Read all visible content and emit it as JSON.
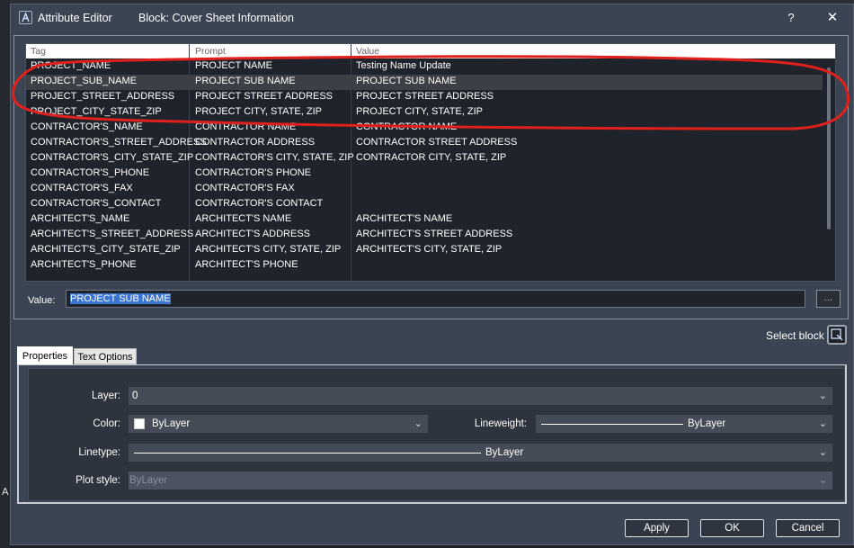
{
  "background": {
    "glyph": "A"
  },
  "window": {
    "title": "Attribute Editor",
    "block_label": "Block: Cover Sheet Information",
    "help": "?",
    "close": "✕"
  },
  "grid": {
    "headers": [
      "Tag",
      "Prompt",
      "Value"
    ],
    "rows": [
      {
        "tag": "PROJECT_NAME",
        "prompt": "PROJECT NAME",
        "value": "Testing Name Update"
      },
      {
        "tag": "PROJECT_SUB_NAME",
        "prompt": "PROJECT SUB NAME",
        "value": "PROJECT SUB NAME",
        "selected": true
      },
      {
        "tag": "PROJECT_STREET_ADDRESS",
        "prompt": "PROJECT STREET ADDRESS",
        "value": "PROJECT STREET ADDRESS"
      },
      {
        "tag": "PROJECT_CITY_STATE_ZIP",
        "prompt": "PROJECT CITY, STATE, ZIP",
        "value": "PROJECT CITY, STATE, ZIP"
      },
      {
        "tag": "CONTRACTOR'S_NAME",
        "prompt": "CONTRACTOR NAME",
        "value": "CONTRACTOR NAME"
      },
      {
        "tag": "CONTRACTOR'S_STREET_ADDRESS",
        "prompt": "CONTRACTOR ADDRESS",
        "value": "CONTRACTOR STREET ADDRESS"
      },
      {
        "tag": "CONTRACTOR'S_CITY_STATE_ZIP",
        "prompt": "CONTRACTOR'S CITY, STATE, ZIP",
        "value": "CONTRACTOR CITY, STATE, ZIP"
      },
      {
        "tag": "CONTRACTOR'S_PHONE",
        "prompt": "CONTRACTOR'S PHONE",
        "value": ""
      },
      {
        "tag": "CONTRACTOR'S_FAX",
        "prompt": "CONTRACTOR'S FAX",
        "value": ""
      },
      {
        "tag": "CONTRACTOR'S_CONTACT",
        "prompt": "CONTRACTOR'S CONTACT",
        "value": ""
      },
      {
        "tag": "ARCHITECT'S_NAME",
        "prompt": "ARCHITECT'S NAME",
        "value": "ARCHITECT'S NAME"
      },
      {
        "tag": "ARCHITECT'S_STREET_ADDRESS",
        "prompt": "ARCHITECT'S ADDRESS",
        "value": "ARCHITECT'S STREET ADDRESS"
      },
      {
        "tag": "ARCHITECT'S_CITY_STATE_ZIP",
        "prompt": "ARCHITECT'S CITY, STATE, ZIP",
        "value": "ARCHITECT'S CITY, STATE, ZIP"
      },
      {
        "tag": "ARCHITECT'S_PHONE",
        "prompt": "ARCHITECT'S PHONE",
        "value": ""
      }
    ]
  },
  "value_editor": {
    "label": "Value:",
    "current": "PROJECT SUB NAME",
    "browse": "..."
  },
  "select_block": {
    "label": "Select block",
    "icon": "select-block-icon"
  },
  "tabs": [
    {
      "label": "Properties",
      "active": true
    },
    {
      "label": "Text Options",
      "active": false
    }
  ],
  "properties": {
    "layer": {
      "label": "Layer:",
      "value": "0"
    },
    "color": {
      "label": "Color:",
      "value": "ByLayer",
      "swatch": "#ffffff"
    },
    "lineweight": {
      "label": "Lineweight:",
      "value": "ByLayer"
    },
    "linetype": {
      "label": "Linetype:",
      "value": "ByLayer"
    },
    "plot_style": {
      "label": "Plot style:",
      "value": "ByLayer",
      "disabled": true
    }
  },
  "buttons": {
    "apply": "Apply",
    "ok": "OK",
    "cancel": "Cancel"
  },
  "colors": {
    "dialog_bg": "#3b4453",
    "grid_bg": "#1f242c",
    "selection": "#3a74d1",
    "annotation": "#e0201c"
  }
}
